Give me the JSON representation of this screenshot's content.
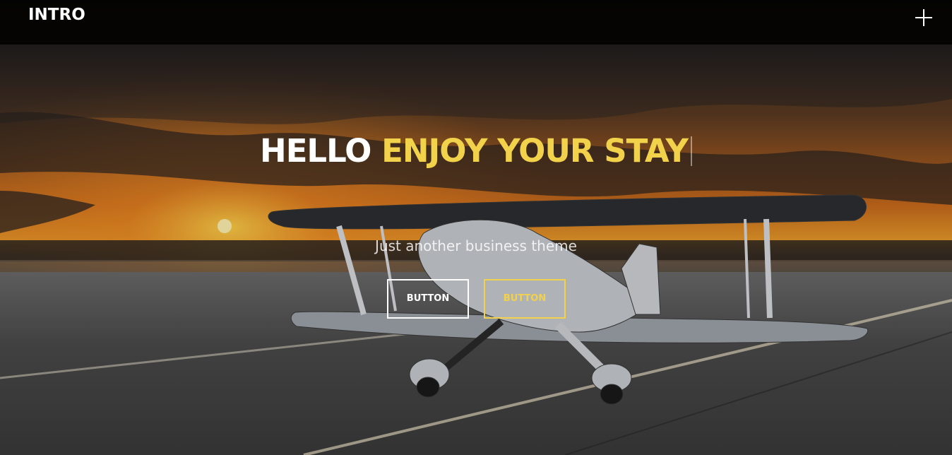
{
  "header": {
    "brand": "INTRO",
    "menu_icon": "plus-icon"
  },
  "hero": {
    "headline_white": "HELLO",
    "headline_yellow": "ENJOY YOUR STAY",
    "subtitle": "Just another business theme",
    "buttons": [
      {
        "label": "BUTTON",
        "style": "outline-white"
      },
      {
        "label": "BUTTON",
        "style": "outline-yellow"
      }
    ],
    "background_image": "sunset-biplane-on-runway"
  },
  "colors": {
    "accent": "#f2d14b",
    "text": "#ffffff",
    "topbar": "#000000"
  }
}
